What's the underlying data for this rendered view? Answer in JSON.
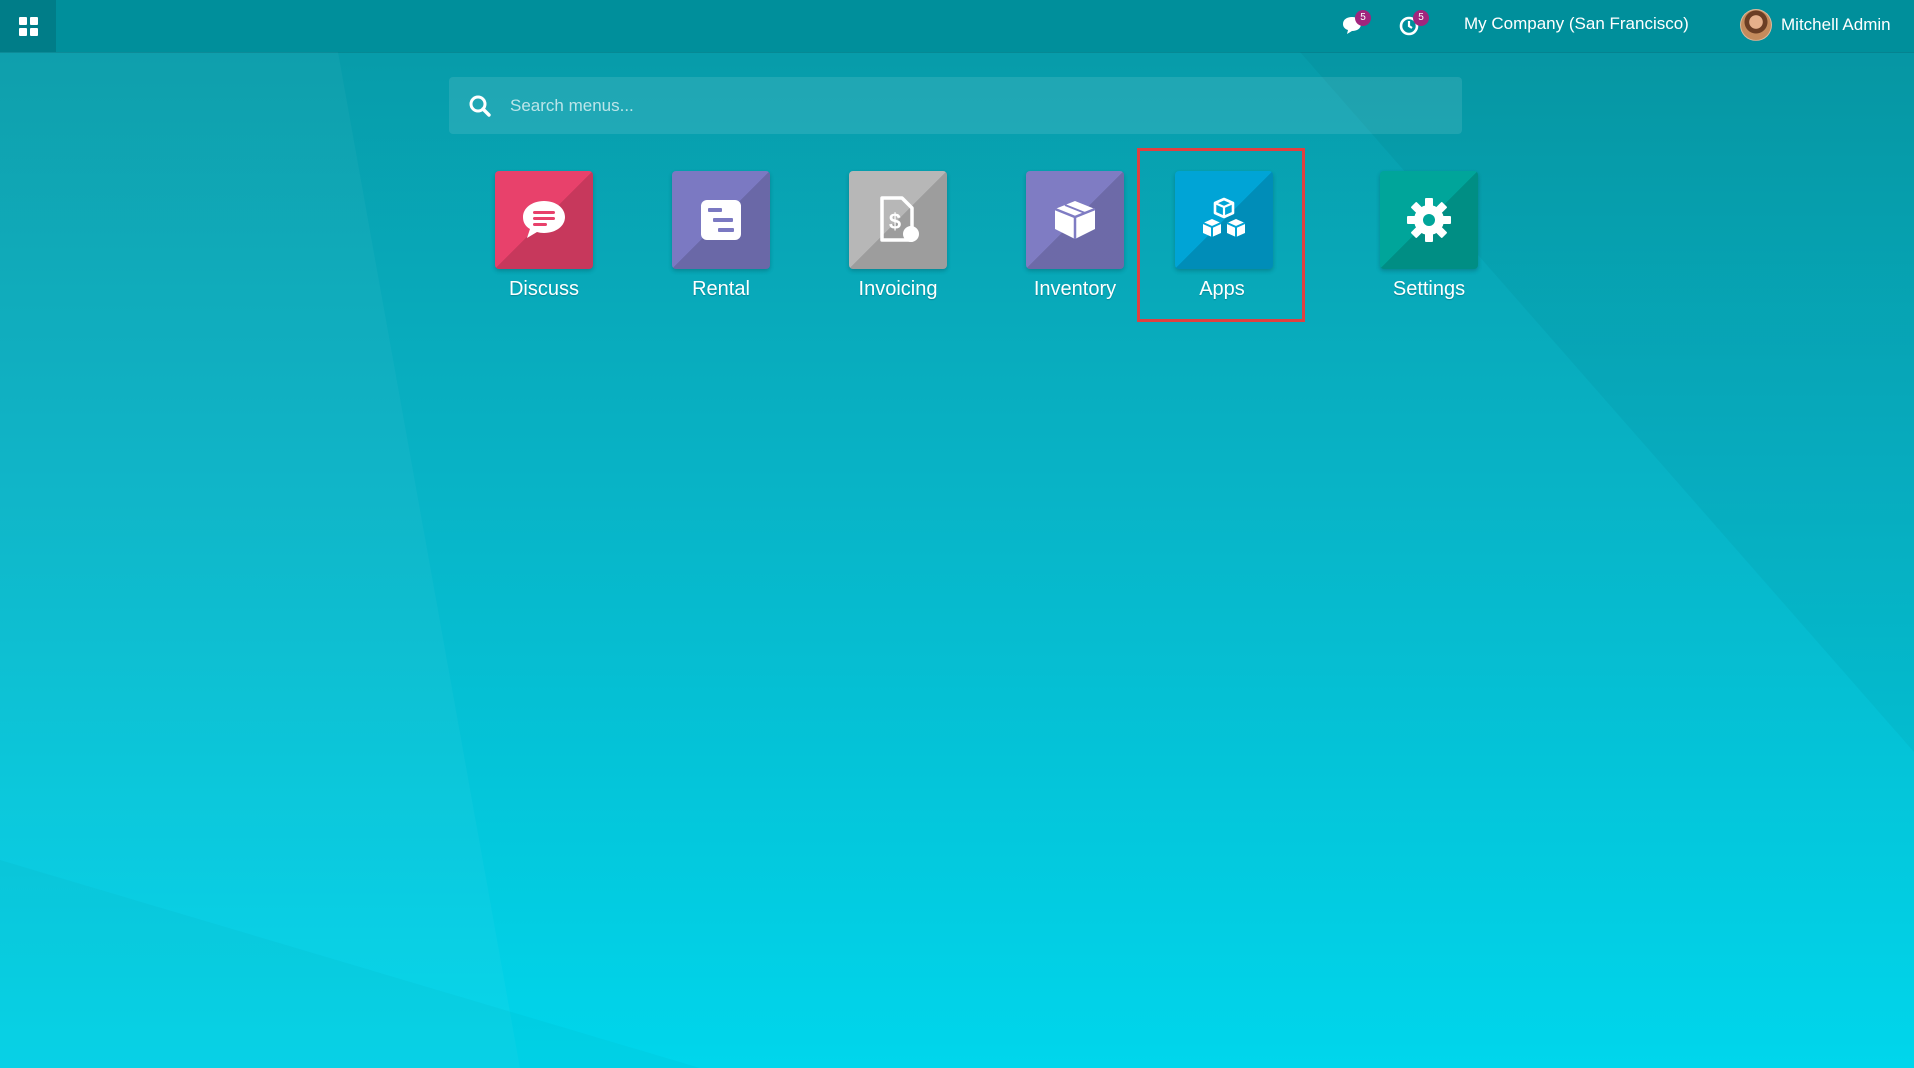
{
  "topbar": {
    "messages_badge": "5",
    "activities_badge": "5",
    "company": "My Company (San Francisco)",
    "user_name": "Mitchell Admin"
  },
  "search": {
    "placeholder": "Search menus..."
  },
  "apps": [
    {
      "label": "Discuss",
      "color": "#e8416b",
      "icon": "chat-bubble-icon"
    },
    {
      "label": "Rental",
      "color": "#7b79c2",
      "icon": "rental-list-icon"
    },
    {
      "label": "Invoicing",
      "color": "#b7b7b7",
      "icon": "invoice-icon"
    },
    {
      "label": "Inventory",
      "color": "#7f7cc3",
      "icon": "box-icon"
    },
    {
      "label": "Apps",
      "color": "#00a4d6",
      "icon": "cubes-icon",
      "selected": true
    },
    {
      "label": "Settings",
      "color": "#00a59a",
      "icon": "gear-icon"
    }
  ],
  "colors": {
    "topbar": "#008f9b",
    "badge": "#a1257d",
    "selection_outline": "#e04040"
  }
}
